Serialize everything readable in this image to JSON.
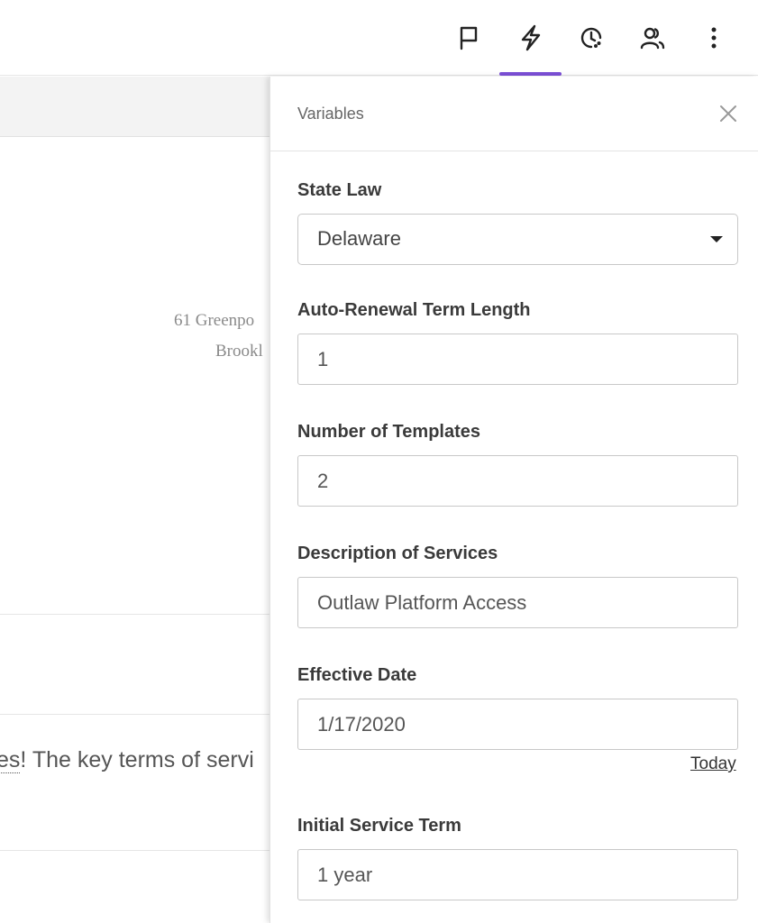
{
  "toolbar": {
    "icons": [
      "flag-icon",
      "lightning-icon",
      "history-icon",
      "users-icon",
      "more-icon"
    ],
    "accent_color": "#7b4fd6"
  },
  "document": {
    "address_line1": "61 Greenpo",
    "address_line2": "Brookl",
    "body_prefix": "es",
    "body_text": "! The key terms of servi"
  },
  "panel": {
    "title": "Variables",
    "fields": {
      "state_law": {
        "label": "State Law",
        "value": "Delaware"
      },
      "auto_renewal": {
        "label": "Auto-Renewal Term Length",
        "value": "1"
      },
      "templates": {
        "label": "Number of Templates",
        "value": "2"
      },
      "description": {
        "label": "Description of Services",
        "value": "Outlaw Platform Access"
      },
      "effective_date": {
        "label": "Effective Date",
        "value": "1/17/2020",
        "today_label": "Today"
      },
      "initial_term": {
        "label": "Initial Service Term",
        "value": "1 year"
      }
    }
  }
}
